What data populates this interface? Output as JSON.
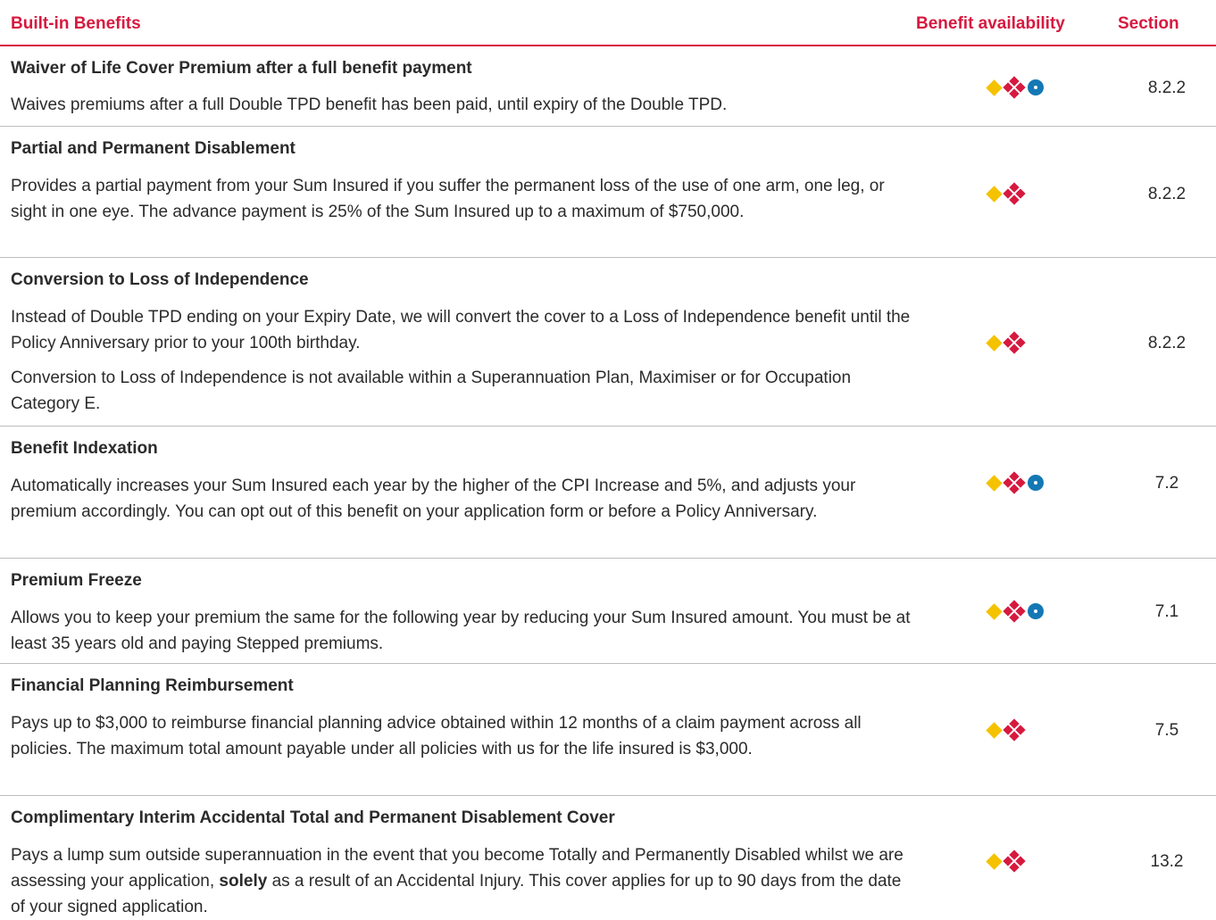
{
  "header": {
    "benefit": "Built-in Benefits",
    "availability": "Benefit availability",
    "section": "Section"
  },
  "colors": {
    "accent": "#d7193f",
    "diamond": "#f5c200",
    "circle": "#1478b4"
  },
  "legend_icons": [
    "diamond-icon",
    "cross-icon",
    "circle-icon"
  ],
  "rows": [
    {
      "title": "Waiver of Life Cover Premium after a full benefit payment",
      "description": "Waives premiums after a full Double TPD benefit has been paid, until expiry of the Double TPD.",
      "icons": [
        "diamond",
        "cross",
        "circle"
      ],
      "section": "8.2.2"
    },
    {
      "title": "Partial and Permanent Disablement",
      "description": "Provides a partial payment from your Sum Insured if you suffer the permanent loss of the use of one arm, one leg, or sight in one eye. The advance payment is 25% of the Sum Insured up to a maximum of $750,000.",
      "icons": [
        "diamond",
        "cross"
      ],
      "section": "8.2.2"
    },
    {
      "title": "Conversion to Loss of Independence",
      "description": "Instead of Double TPD ending on your Expiry Date, we will convert the cover to a Loss of Independence benefit until the Policy Anniversary prior to your 100th birthday.",
      "description2": "Conversion to Loss of Independence is not available within a Superannuation Plan, Maximiser or for Occupation Category E.",
      "icons": [
        "diamond",
        "cross"
      ],
      "section": "8.2.2"
    },
    {
      "title": "Benefit Indexation",
      "description": "Automatically increases your Sum Insured each year by the higher of the CPI Increase and 5%, and adjusts your premium accordingly. You can opt out of this benefit on your application form or before a Policy Anniversary.",
      "icons": [
        "diamond",
        "cross",
        "circle"
      ],
      "section": "7.2"
    },
    {
      "title": "Premium Freeze",
      "description": "Allows you to keep your premium the same for the following year by reducing your Sum Insured amount. You must be at least 35 years old and paying Stepped premiums.",
      "icons": [
        "diamond",
        "cross",
        "circle"
      ],
      "section": "7.1"
    },
    {
      "title": "Financial Planning Reimbursement",
      "description": "Pays up to $3,000 to reimburse financial planning advice obtained within 12 months of a claim payment across all policies. The maximum total amount payable under all policies with us for the life insured is $3,000.",
      "icons": [
        "diamond",
        "cross"
      ],
      "section": "7.5"
    },
    {
      "title": "Complimentary Interim Accidental Total and Permanent Disablement Cover",
      "description_pre": "Pays a lump sum outside superannuation in the event that you become Totally and Permanently Disabled whilst we are assessing your application, ",
      "description_bold": "solely",
      "description_post": " as a result of an Accidental Injury. This cover applies for up to 90 days from the date of your signed application.",
      "icons": [
        "diamond",
        "cross"
      ],
      "section": "13.2"
    }
  ]
}
